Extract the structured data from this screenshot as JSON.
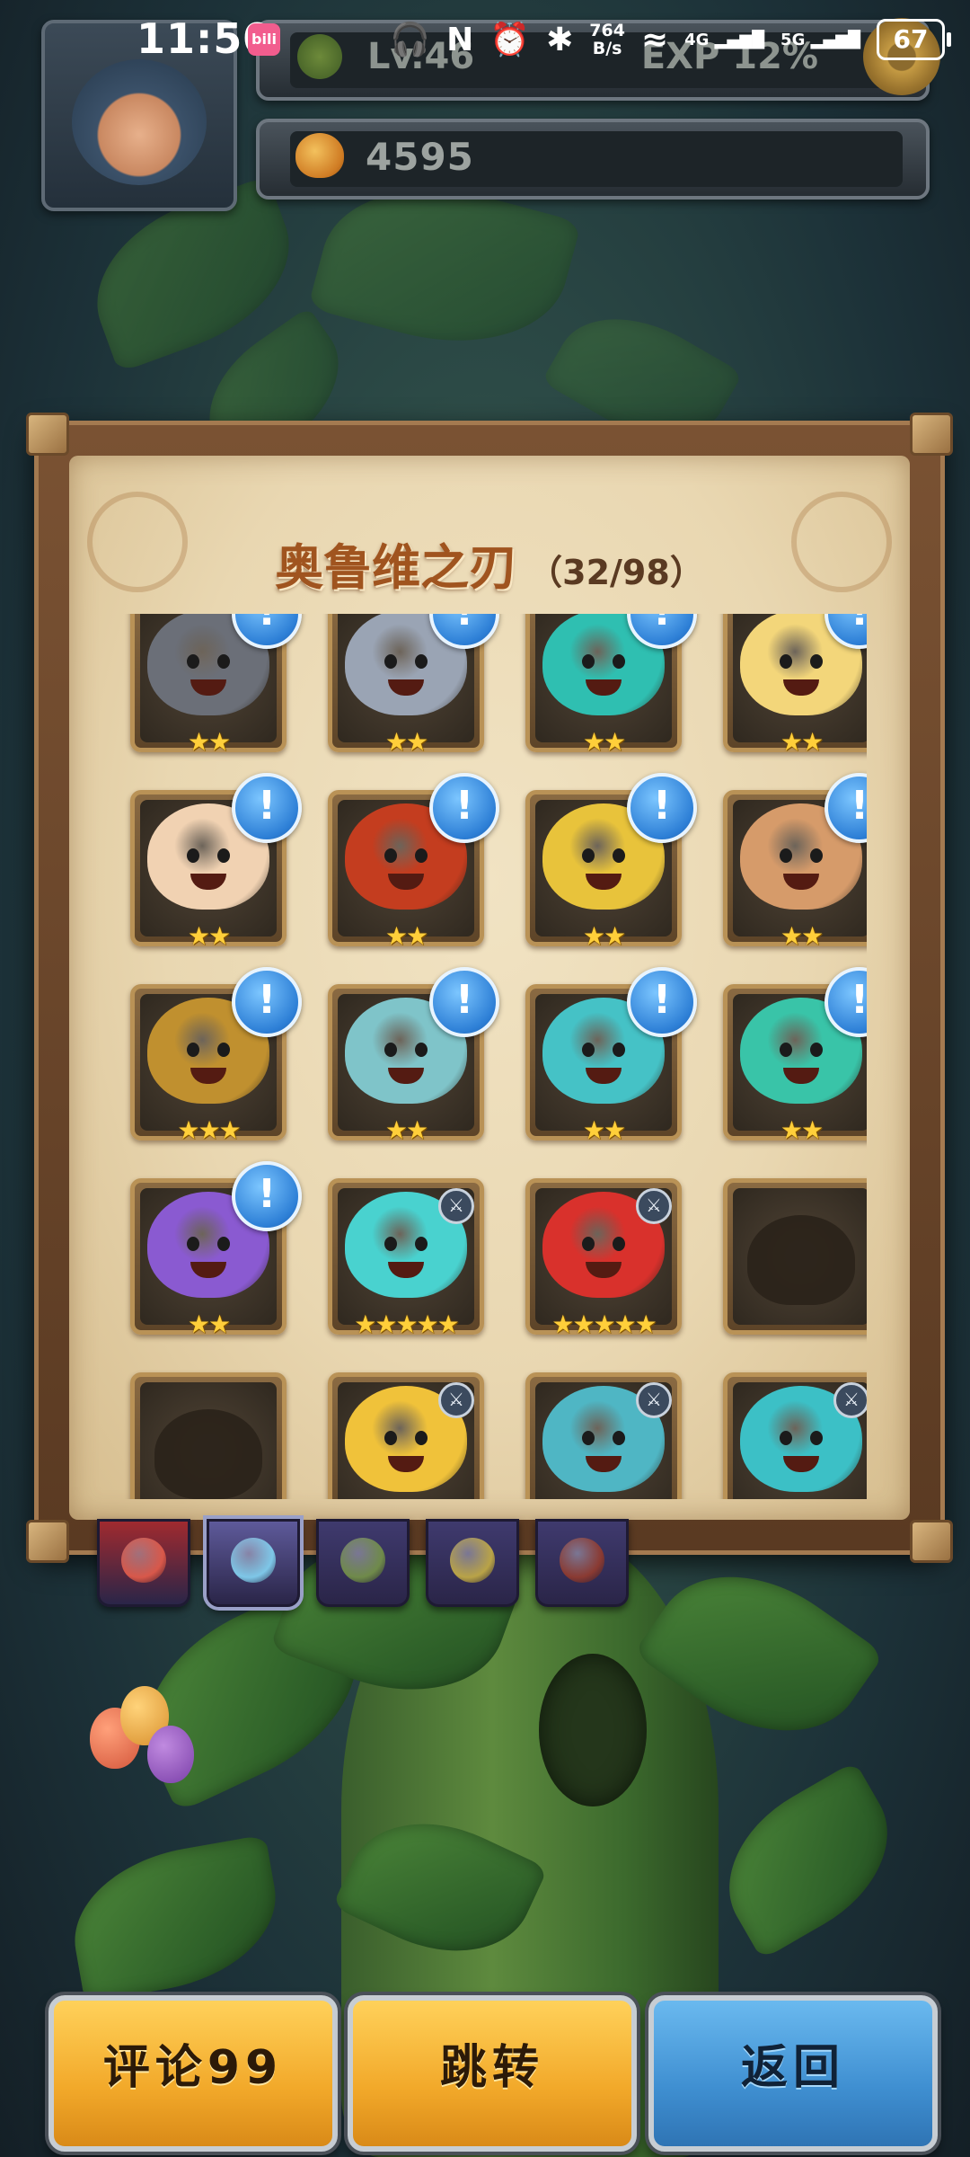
{
  "status_bar": {
    "time": "11:50",
    "app_badge": "bili",
    "net_speed_value": "764",
    "net_speed_unit": "B/s",
    "signal_1": "4G",
    "signal_2": "5G",
    "battery": "67"
  },
  "player": {
    "level": "Lv.46",
    "exp": "EXP 12%",
    "currency": "4595"
  },
  "album": {
    "title": "奥鲁维之刃",
    "count": "（32/98）",
    "cards": [
      {
        "stars": "★★",
        "alert": true,
        "color": "#6b6f78",
        "locked": false
      },
      {
        "stars": "★★",
        "alert": true,
        "color": "#9aa4b4",
        "locked": false
      },
      {
        "stars": "★★",
        "alert": true,
        "color": "#2fbfb1",
        "locked": false
      },
      {
        "stars": "★★",
        "alert": true,
        "color": "#f3d67a",
        "locked": false
      },
      {
        "stars": "★★",
        "alert": true,
        "color": "#f1d2b2",
        "locked": false
      },
      {
        "stars": "★★",
        "alert": true,
        "color": "#c43d1f",
        "locked": false
      },
      {
        "stars": "★★",
        "alert": true,
        "color": "#e8c33b",
        "locked": false
      },
      {
        "stars": "★★",
        "alert": true,
        "color": "#d69b6a",
        "locked": false
      },
      {
        "stars": "★★★",
        "alert": true,
        "color": "#c0902f",
        "locked": false
      },
      {
        "stars": "★★",
        "alert": true,
        "color": "#7fc4c9",
        "locked": false
      },
      {
        "stars": "★★",
        "alert": true,
        "color": "#45c2c6",
        "locked": false
      },
      {
        "stars": "★★",
        "alert": true,
        "color": "#39c4a8",
        "locked": false
      },
      {
        "stars": "★★",
        "alert": true,
        "color": "#8a5ad1",
        "locked": false
      },
      {
        "stars": "★★★★★",
        "alert": false,
        "color": "#49d2cf",
        "locked": false
      },
      {
        "stars": "★★★★★",
        "alert": false,
        "color": "#d9312c",
        "locked": false
      },
      {
        "stars": "",
        "alert": false,
        "color": "#2a221a",
        "locked": true
      },
      {
        "stars": "",
        "alert": false,
        "color": "#2a221a",
        "locked": true
      },
      {
        "stars": "",
        "alert": false,
        "color": "#f0c23a",
        "locked": false
      },
      {
        "stars": "",
        "alert": false,
        "color": "#4fb6c4",
        "locked": false
      },
      {
        "stars": "",
        "alert": false,
        "color": "#3cc0c6",
        "locked": false
      }
    ]
  },
  "faction_tabs": [
    {
      "color": "#a02a2f",
      "emblem": "#d8584a"
    },
    {
      "color": "#5e5a9a",
      "emblem": "#7ec7e8"
    },
    {
      "color": "#3f3a6e",
      "emblem": "#6f8a4a"
    },
    {
      "color": "#3f3a6e",
      "emblem": "#b9a347"
    },
    {
      "color": "#3f3a6e",
      "emblem": "#8a3a32"
    }
  ],
  "buttons": {
    "comment": "评论99",
    "jump": "跳转",
    "back": "返回"
  },
  "colors": {
    "alert_blue": "#2d7fd6",
    "button_yellow": "#f2a92a",
    "button_blue": "#3f8fd1",
    "title_brown": "#a0541f"
  }
}
